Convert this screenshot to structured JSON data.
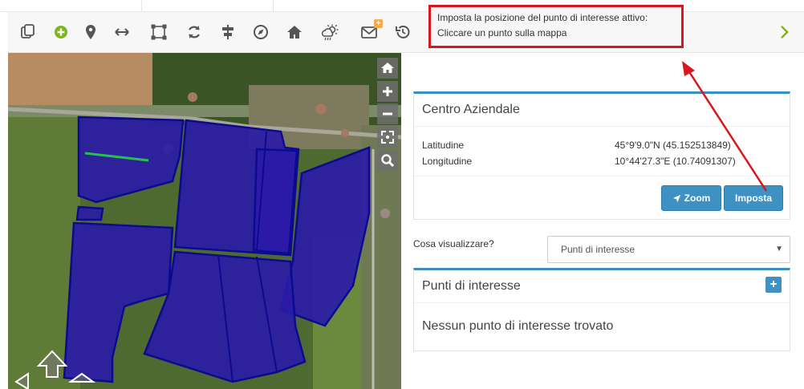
{
  "toolbar": {
    "icons": [
      "copy-icon",
      "add-point-icon",
      "map-marker-icon",
      "horizontal-arrows-icon",
      "polygon-select-icon",
      "refresh-icon",
      "align-center-icon",
      "compass-icon",
      "home-icon",
      "weather-icon",
      "mail-icon",
      "history-icon"
    ],
    "mail_badge": "+",
    "next_icon": "chevron-right-icon",
    "accent": "#7cb518"
  },
  "hint": {
    "line1": "Imposta la posizione del punto di interesse attivo:",
    "line2": "Cliccare un punto sulla mappa"
  },
  "map": {
    "controls": [
      "home-icon",
      "zoom-in-icon",
      "zoom-out-icon",
      "fullscreen-icon",
      "search-icon"
    ],
    "parcel_color": "#2a1aa8"
  },
  "centro": {
    "title": "Centro Aziendale",
    "lat_label": "Latitudine",
    "lat_value": "45°9'9.0\"N (45.152513849)",
    "lon_label": "Longitudine",
    "lon_value": "10°44'27.3\"E (10.74091307)",
    "zoom_label": "Zoom",
    "imposta_label": "Imposta"
  },
  "view_select": {
    "label": "Cosa visualizzare?",
    "value": "Punti di interesse"
  },
  "punti": {
    "title": "Punti di interesse",
    "add_label": "+",
    "empty": "Nessun punto di interesse trovato"
  },
  "colors": {
    "primary": "#3f91c3",
    "annotation": "#d9161c"
  }
}
